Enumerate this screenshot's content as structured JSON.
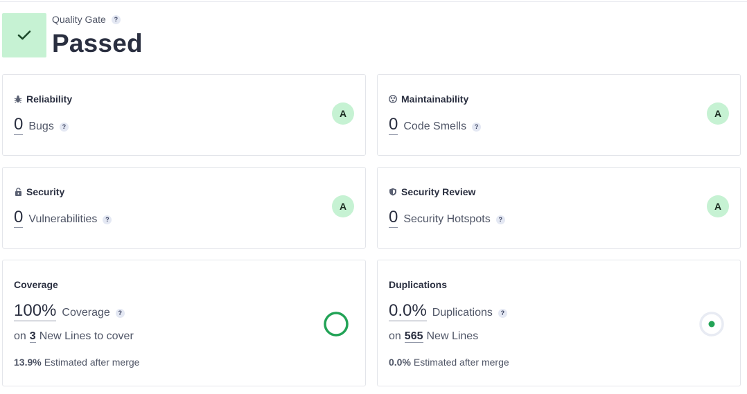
{
  "quality_gate": {
    "label": "Quality Gate",
    "status": "Passed",
    "help": "?"
  },
  "cards": {
    "reliability": {
      "title": "Reliability",
      "value": "0",
      "label": "Bugs",
      "help": "?",
      "rating": "A"
    },
    "maintainability": {
      "title": "Maintainability",
      "value": "0",
      "label": "Code Smells",
      "help": "?",
      "rating": "A"
    },
    "security": {
      "title": "Security",
      "value": "0",
      "label": "Vulnerabilities",
      "help": "?",
      "rating": "A"
    },
    "security_review": {
      "title": "Security Review",
      "value": "0",
      "label": "Security Hotspots",
      "help": "?",
      "rating": "A"
    },
    "coverage": {
      "title": "Coverage",
      "value": "100%",
      "label": "Coverage",
      "help": "?",
      "sub_prefix": "on",
      "sub_num": "3",
      "sub_suffix": "New Lines to cover",
      "est_value": "13.9%",
      "est_label": "Estimated after merge",
      "gauge_fraction": 1.0
    },
    "duplications": {
      "title": "Duplications",
      "value": "0.0%",
      "label": "Duplications",
      "help": "?",
      "sub_prefix": "on",
      "sub_num": "565",
      "sub_suffix": "New Lines",
      "est_value": "0.0%",
      "est_label": "Estimated after merge",
      "gauge_fraction": 0.0
    }
  },
  "colors": {
    "pass_green": "#c6f2d3",
    "check_dark": "#1d4a2b",
    "coverage_ring": "#22a356",
    "dup_dot": "#22a356",
    "dup_ring": "#e8ebf3"
  },
  "icons": {
    "reliability": "bug-icon",
    "maintainability": "smell-icon",
    "security": "lock-icon",
    "security_review": "shield-icon"
  }
}
